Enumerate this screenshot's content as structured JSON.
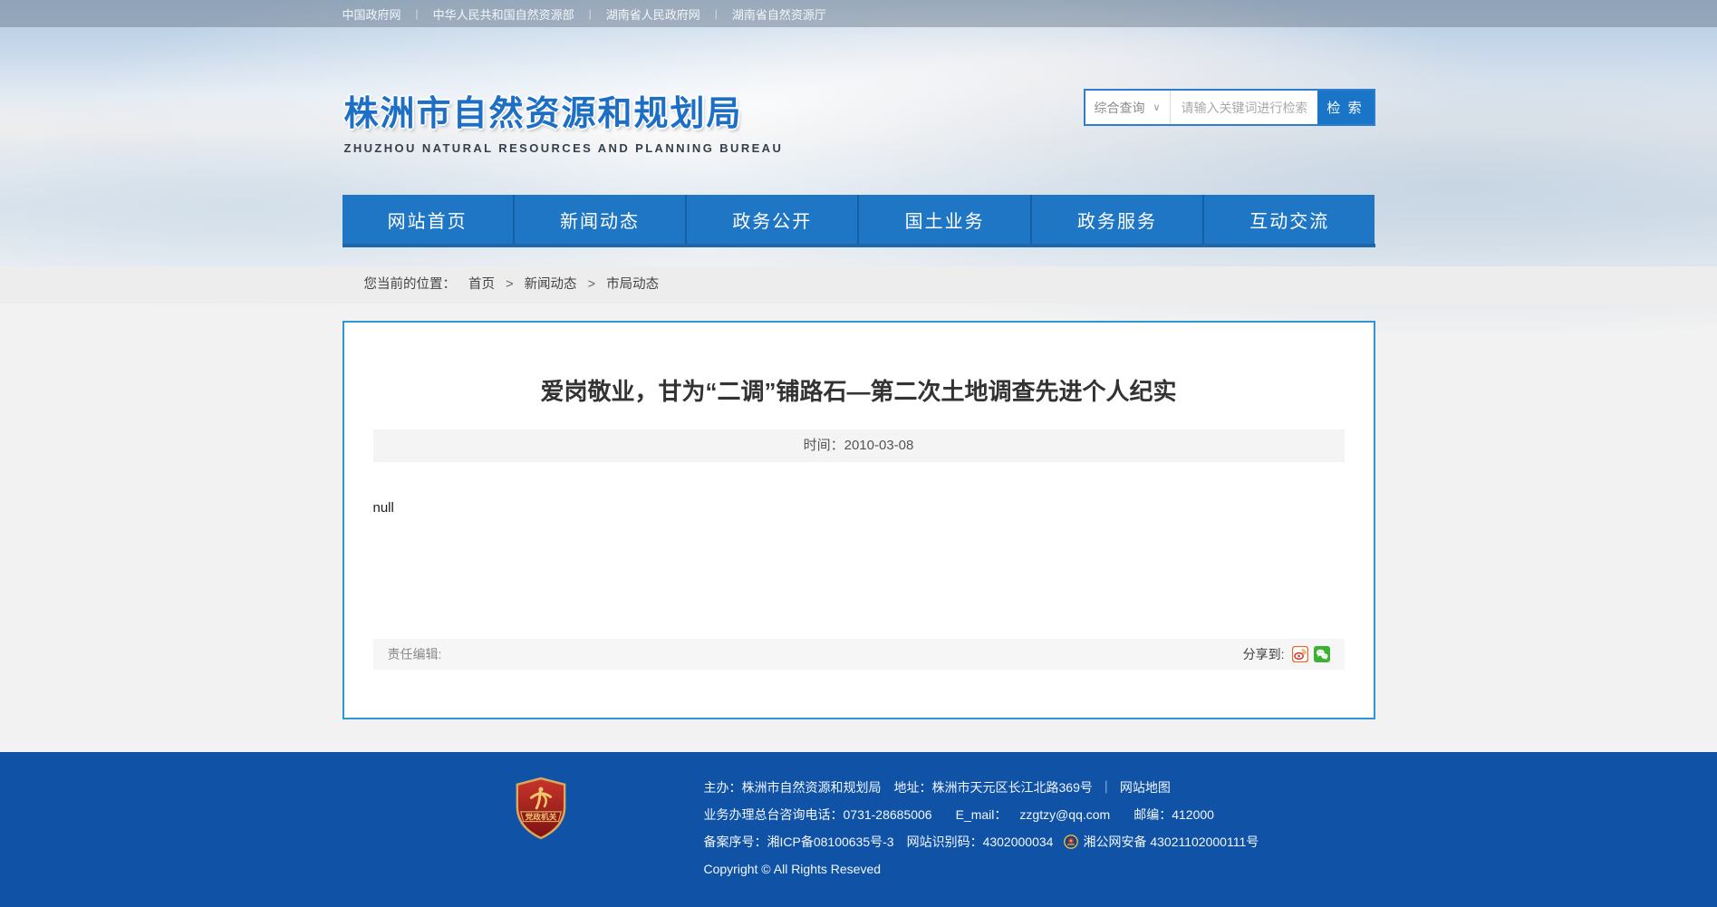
{
  "topbar": {
    "links": [
      "中国政府网",
      "中华人民共和国自然资源部",
      "湖南省人民政府网",
      "湖南省自然资源厅"
    ],
    "separator": "|"
  },
  "header": {
    "site_title": "株洲市自然资源和规划局",
    "site_subtitle": "ZHUZHOU NATURAL RESOURCES AND PLANNING BUREAU",
    "search": {
      "category": "综合查询",
      "chevron": "∨",
      "placeholder": "请输入关键词进行检索",
      "button": "检 索"
    }
  },
  "nav": {
    "items": [
      "网站首页",
      "新闻动态",
      "政务公开",
      "国土业务",
      "政务服务",
      "互动交流"
    ]
  },
  "breadcrumb": {
    "label": "您当前的位置：",
    "items": [
      "首页",
      "新闻动态",
      "市局动态"
    ],
    "separator": ">"
  },
  "article": {
    "title": "爱岗敬业，甘为“二调”铺路石—第二次土地调查先进个人纪实",
    "meta_time": "时间：2010-03-08",
    "body": "null",
    "editor_label": "责任编辑:",
    "share_label": "分享到:",
    "share_icons": [
      "sina-weibo-icon",
      "wechat-icon"
    ]
  },
  "footer": {
    "badge_text": "党政机关",
    "org_line": {
      "host": "主办：株洲市自然资源和规划局",
      "address": "地址：株洲市天元区长江北路369号",
      "divider": "｜",
      "sitemap": "网站地图"
    },
    "contact_line": {
      "phone": "业务办理总台咨询电话：0731-28685006",
      "email_label": "E_mail：",
      "email": "zzgtzy@qq.com",
      "postcode": "邮编：412000"
    },
    "record_line": {
      "icp": "备案序号：湘ICP备08100635号-3",
      "site_code": "网站识别码：4302000034",
      "police_record": "湘公网安备 43021102000111号"
    },
    "copyright": "Copyright © All Rights Reseved",
    "colors": {
      "footer_bg": "#0f52a6",
      "nav_bg": "#1e76c4",
      "accent_blue": "#2e96d6"
    }
  }
}
